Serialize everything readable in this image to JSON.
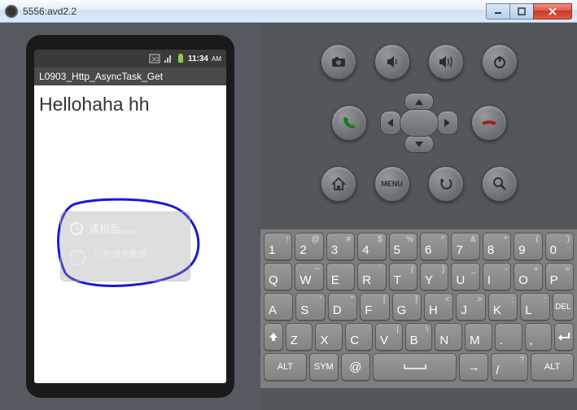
{
  "window": {
    "title": "5556:avd2.2"
  },
  "statusbar": {
    "time": "11:34",
    "ampm": "AM"
  },
  "app": {
    "title": "L0903_Http_AsyncTask_Get",
    "greeting": "Hellohaha hh",
    "toast_line1": "请稍后。。。",
    "toast_line2": "正在请求数据"
  },
  "hw": {
    "menu_label": "MENU"
  },
  "keys": {
    "row1": [
      {
        "m": "1",
        "s": "!"
      },
      {
        "m": "2",
        "s": "@"
      },
      {
        "m": "3",
        "s": "#"
      },
      {
        "m": "4",
        "s": "$"
      },
      {
        "m": "5",
        "s": "%"
      },
      {
        "m": "6",
        "s": "^"
      },
      {
        "m": "7",
        "s": "&"
      },
      {
        "m": "8",
        "s": "*"
      },
      {
        "m": "9",
        "s": "("
      },
      {
        "m": "0",
        "s": ")"
      }
    ],
    "row2": [
      {
        "m": "Q"
      },
      {
        "m": "W",
        "s": "~"
      },
      {
        "m": "E",
        "s": "¨"
      },
      {
        "m": "R",
        "s": "`"
      },
      {
        "m": "T",
        "s": "{"
      },
      {
        "m": "Y",
        "s": "}"
      },
      {
        "m": "U",
        "s": "_"
      },
      {
        "m": "I",
        "s": "-"
      },
      {
        "m": "O",
        "s": "+"
      },
      {
        "m": "P",
        "s": "="
      }
    ],
    "row3": [
      {
        "m": "A"
      },
      {
        "m": "S",
        "s": "'"
      },
      {
        "m": "D",
        "s": "\""
      },
      {
        "m": "F",
        "s": "["
      },
      {
        "m": "G",
        "s": "]"
      },
      {
        "m": "H",
        "s": "<"
      },
      {
        "m": "J",
        "s": ">"
      },
      {
        "m": "K",
        "s": ";"
      },
      {
        "m": "L",
        "s": ":"
      }
    ],
    "del": "DEL",
    "row4": [
      {
        "m": "Z"
      },
      {
        "m": "X"
      },
      {
        "m": "C"
      },
      {
        "m": "V",
        "s": "|"
      },
      {
        "m": "B",
        "s": "\\"
      },
      {
        "m": "N"
      },
      {
        "m": "M"
      },
      {
        "m": "."
      },
      {
        "m": ","
      }
    ],
    "row5": {
      "alt": "ALT",
      "sym": "SYM",
      "at": "@",
      "slash": "/",
      "qmark": "?",
      "alt2": "ALT"
    }
  }
}
